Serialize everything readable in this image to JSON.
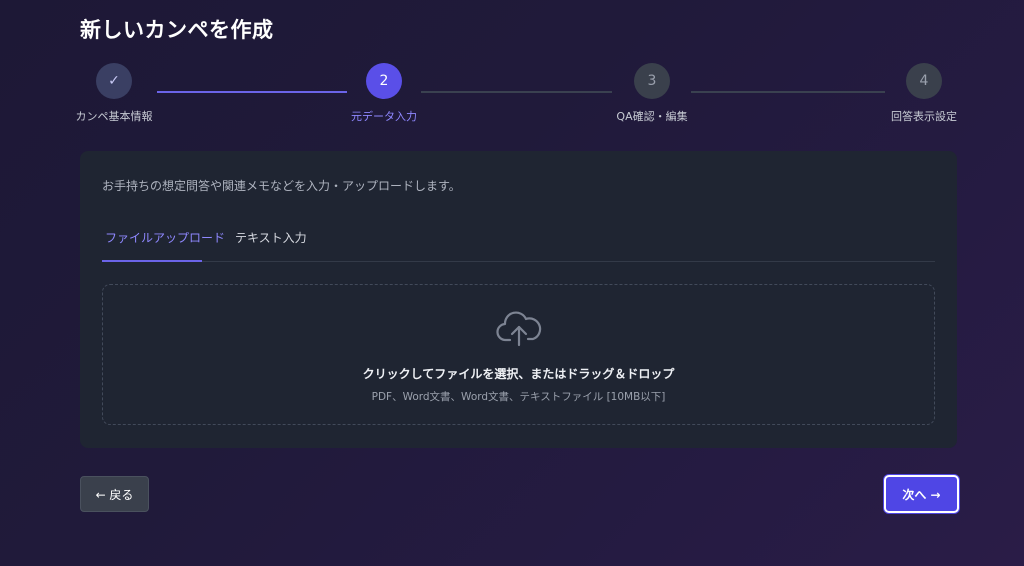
{
  "page": {
    "title": "新しいカンペを作成"
  },
  "stepper": {
    "steps": [
      {
        "number": "✓",
        "label": "カンペ基本情報",
        "state": "done"
      },
      {
        "number": "2",
        "label": "元データ入力",
        "state": "active"
      },
      {
        "number": "3",
        "label": "QA確認・編集",
        "state": "pending"
      },
      {
        "number": "4",
        "label": "回答表示設定",
        "state": "pending"
      }
    ]
  },
  "card": {
    "description": "お手持ちの想定問答や関連メモなどを入力・アップロードします。",
    "tabs": [
      {
        "label": "ファイルアップロード",
        "active": true
      },
      {
        "label": "テキスト入力",
        "active": false
      }
    ],
    "dropzone": {
      "icon": "cloud-upload-icon",
      "title": "クリックしてファイルを選択、またはドラッグ＆ドロップ",
      "subtitle": "PDF、Word文書、Word文書、テキストファイル [10MB以下]"
    }
  },
  "actions": {
    "back_label": "← 戻る",
    "next_label": "次へ →"
  },
  "colors": {
    "accent": "#5a4fe8",
    "card": "#1f2532",
    "background": "#1d1836"
  }
}
